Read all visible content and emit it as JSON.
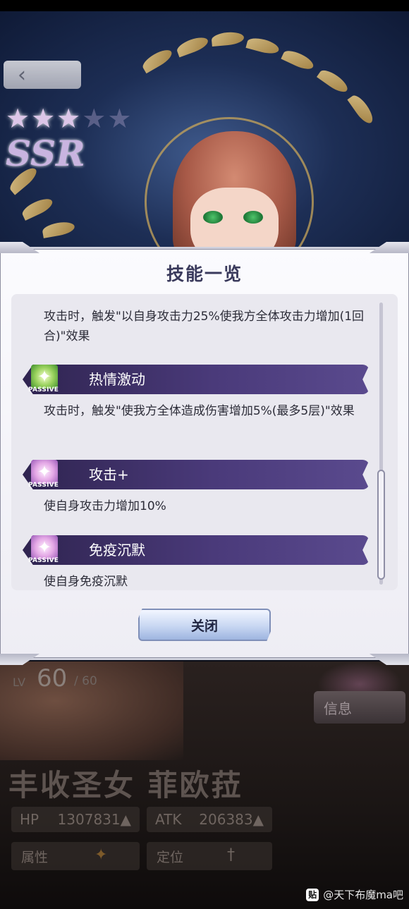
{
  "background": {
    "rarity": "SSR",
    "stars_filled": 3,
    "stars_total": 5,
    "level_label": "LV",
    "level": "60",
    "level_max": "/ 60",
    "info_button": "信息",
    "character_name": "丰收圣女 菲欧菈",
    "stats": [
      {
        "label": "HP",
        "value": "1307831▲"
      },
      {
        "label": "ATK",
        "value": "206383▲"
      }
    ],
    "meta": [
      {
        "label": "属性"
      },
      {
        "label": "定位"
      }
    ]
  },
  "dialog": {
    "title": "技能一览",
    "close_button": "关闭",
    "top_description": "攻击时，触发\"以自身攻击力25%使我方全体攻击力增加(1回合)\"效果",
    "skills": [
      {
        "name": "热情激动",
        "tag": "PASSIVE",
        "icon": "green-sparkle-icon",
        "description": "攻击时，触发\"使我方全体造成伤害增加5%(最多5层)\"效果"
      },
      {
        "name": "攻击+",
        "tag": "PASSIVE",
        "icon": "pink-sparkle-icon",
        "description": "使自身攻击力增加10%"
      },
      {
        "name": "免疫沉默",
        "tag": "PASSIVE",
        "icon": "pink-sparkle-icon",
        "description": "使自身免疫沉默"
      }
    ]
  },
  "watermark": "@天下布魔ma吧",
  "colors": {
    "skill_bar": "#3d2f6a",
    "dialog_bg": "#f4f3f8",
    "title": "#3a3a5c"
  }
}
